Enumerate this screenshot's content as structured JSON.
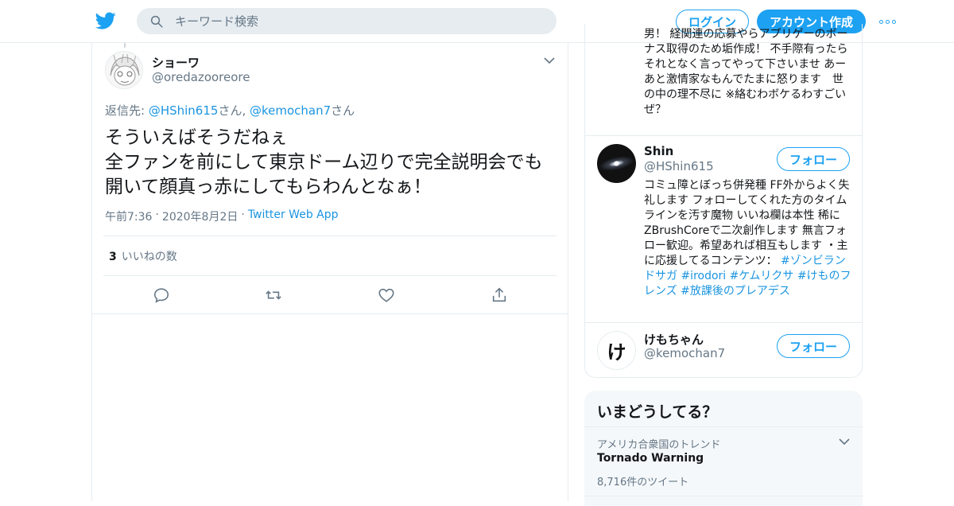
{
  "header": {
    "search_placeholder": "キーワード検索",
    "login_label": "ログイン",
    "signup_label": "アカウント作成"
  },
  "tweet": {
    "author_name": "ショーワ",
    "author_handle": "@oredazooreore",
    "reply_prefix": "返信先: ",
    "reply_user1": "@HShin615",
    "reply_san1": "さん, ",
    "reply_user2": "@kemochan7",
    "reply_san2": "さん",
    "text": "そういえばそうだねぇ\n全ファンを前にして東京ドーム辺りで完全説明会でも開いて顔真っ赤にしてもらわんとなぁ！",
    "time": "午前7:36",
    "date": "2020年8月2日",
    "sep": "·",
    "app": "Twitter Web App",
    "likes_count": "3",
    "likes_label": "いいねの数"
  },
  "sidebar": {
    "bio_top": "男！ 経関連の応募やらアプリゲーのボーナス取得のため垢作成！ 不手際有ったらそれとなく言ってやって下さいませ あーあと激情家なもんでたまに怒ります　世の中の理不尽に ※絡むわボケるわすごいぜ？",
    "users": [
      {
        "name": "Shin",
        "handle": "@HShin615",
        "follow_label": "フォロー",
        "bio_text": "コミュ障とぼっち併発種 FF外からよく失礼します フォローしてくれた方のタイムラインを汚す魔物 いいね欄は本性 稀にZBrushCoreで二次創作します 無言フォロー歓迎。希望あれば相互もします ・主に応援してるコンテンツ： ",
        "bio_tags": "#ゾンビランドサガ #irodori #ケムリクサ #けものフレンズ #放課後のプレアデス"
      },
      {
        "name": "けもちゃん",
        "handle": "@kemochan7",
        "follow_label": "フォロー",
        "avatar_char": "け"
      }
    ]
  },
  "trends": {
    "title": "いまどうしてる？",
    "items": [
      {
        "context": "アメリカ合衆国のトレンド",
        "name": "Tornado Warning",
        "count": "8,716件のツイート"
      }
    ]
  },
  "colors": {
    "accent": "#1da1f2",
    "link": "#1b95e0",
    "muted": "#657786",
    "border": "#e6ecf0"
  },
  "icons": [
    "twitter-bird-icon",
    "search-icon",
    "more-icon",
    "chevron-down-icon",
    "reply-icon",
    "retweet-icon",
    "like-icon",
    "share-icon"
  ]
}
